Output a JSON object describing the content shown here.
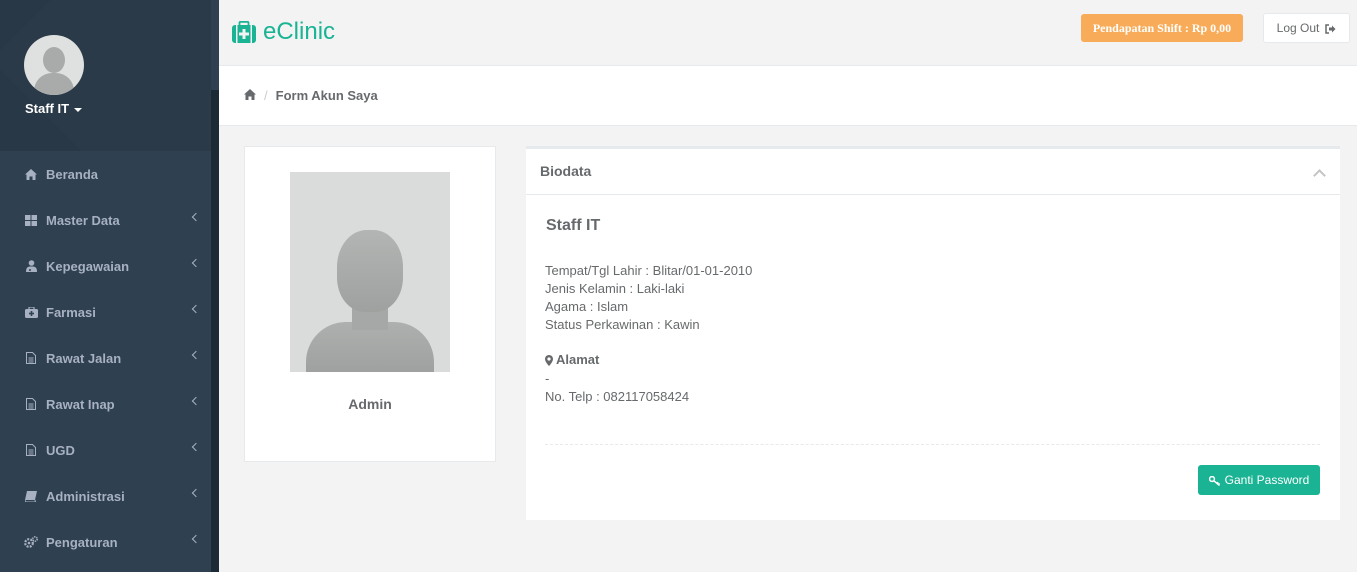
{
  "app": {
    "brand": "eClinic"
  },
  "user": {
    "name": "Staff IT"
  },
  "sidebar": {
    "items": [
      {
        "label": "Beranda",
        "icon": "home-icon",
        "has_submenu": false
      },
      {
        "label": "Master Data",
        "icon": "th-large-icon",
        "has_submenu": true
      },
      {
        "label": "Kepegawaian",
        "icon": "user-md-icon",
        "has_submenu": true
      },
      {
        "label": "Farmasi",
        "icon": "medkit-icon",
        "has_submenu": true
      },
      {
        "label": "Rawat Jalan",
        "icon": "file-text-icon",
        "has_submenu": true
      },
      {
        "label": "Rawat Inap",
        "icon": "file-text-icon",
        "has_submenu": true
      },
      {
        "label": "UGD",
        "icon": "file-text-icon",
        "has_submenu": true
      },
      {
        "label": "Administrasi",
        "icon": "book-icon",
        "has_submenu": true
      },
      {
        "label": "Pengaturan",
        "icon": "cogs-icon",
        "has_submenu": true
      }
    ]
  },
  "header": {
    "shift_label": "Pendapatan Shift : Rp 0,00",
    "logout_label": "Log Out"
  },
  "breadcrumb": {
    "current": "Form Akun Saya"
  },
  "photo_card": {
    "name": "Admin"
  },
  "biodata": {
    "title": "Biodata",
    "name": "Staff IT",
    "tempat_tgl_lahir": "Tempat/Tgl Lahir : Blitar/01-01-2010",
    "jenis_kelamin": "Jenis Kelamin : Laki-laki",
    "agama": "Agama : Islam",
    "status_perkawinan": "Status Perkawinan : Kawin",
    "alamat_label": "Alamat",
    "alamat_value": "-",
    "telp": "No. Telp : 082117058424",
    "password_button": "Ganti Password"
  },
  "colors": {
    "sidebar_bg": "#2f4050",
    "accent_green": "#1ab394",
    "warning_orange": "#f8ac59",
    "nav_text": "#a7b1c2"
  }
}
